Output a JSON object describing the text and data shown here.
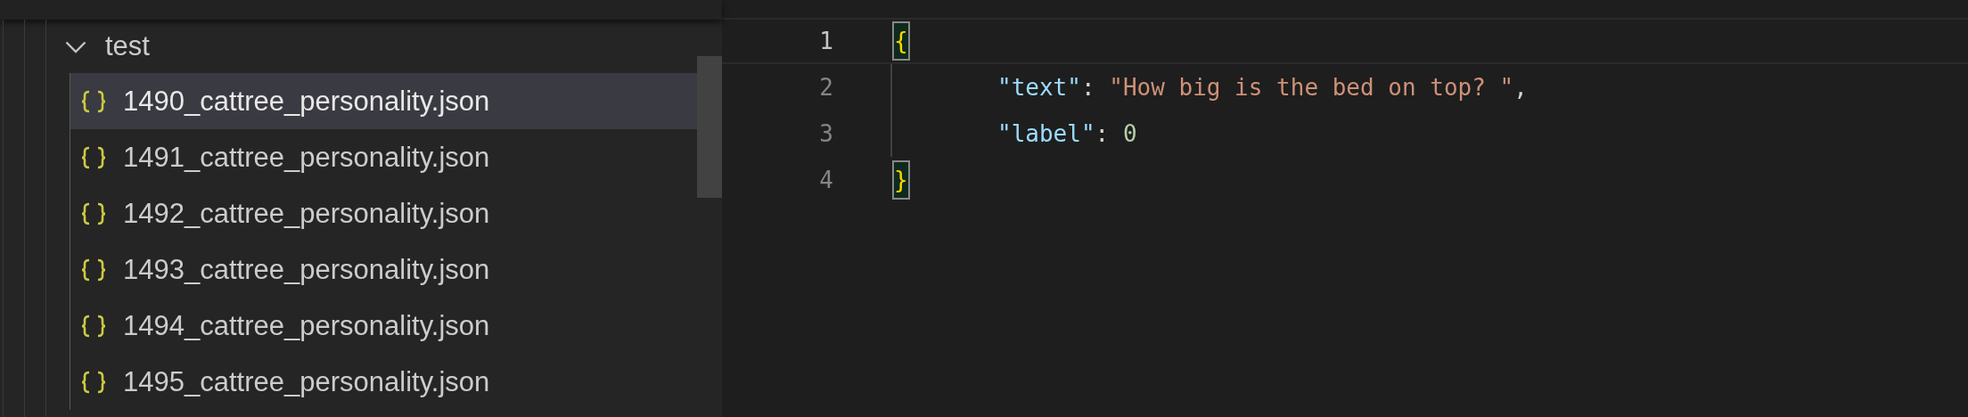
{
  "explorer": {
    "folder": {
      "name": "test",
      "expanded": true
    },
    "files": [
      {
        "name": "1490_cattree_personality.json",
        "selected": true
      },
      {
        "name": "1491_cattree_personality.json",
        "selected": false
      },
      {
        "name": "1492_cattree_personality.json",
        "selected": false
      },
      {
        "name": "1493_cattree_personality.json",
        "selected": false
      },
      {
        "name": "1494_cattree_personality.json",
        "selected": false
      },
      {
        "name": "1495_cattree_personality.json",
        "selected": false
      }
    ]
  },
  "editor": {
    "lines": [
      {
        "number": "1",
        "current": true,
        "indented": false,
        "tokens": [
          {
            "kind": "bracket",
            "text": "{"
          }
        ]
      },
      {
        "number": "2",
        "current": false,
        "indented": true,
        "tokens": [
          {
            "kind": "key",
            "text": "\"text\""
          },
          {
            "kind": "punct",
            "text": ": "
          },
          {
            "kind": "string",
            "text": "\"How big is the bed on top? \""
          },
          {
            "kind": "punct",
            "text": ","
          }
        ]
      },
      {
        "number": "3",
        "current": false,
        "indented": true,
        "tokens": [
          {
            "kind": "key",
            "text": "\"label\""
          },
          {
            "kind": "punct",
            "text": ": "
          },
          {
            "kind": "number",
            "text": "0"
          }
        ]
      },
      {
        "number": "4",
        "current": false,
        "indented": false,
        "tokens": [
          {
            "kind": "bracket",
            "text": "}"
          }
        ]
      }
    ]
  }
}
